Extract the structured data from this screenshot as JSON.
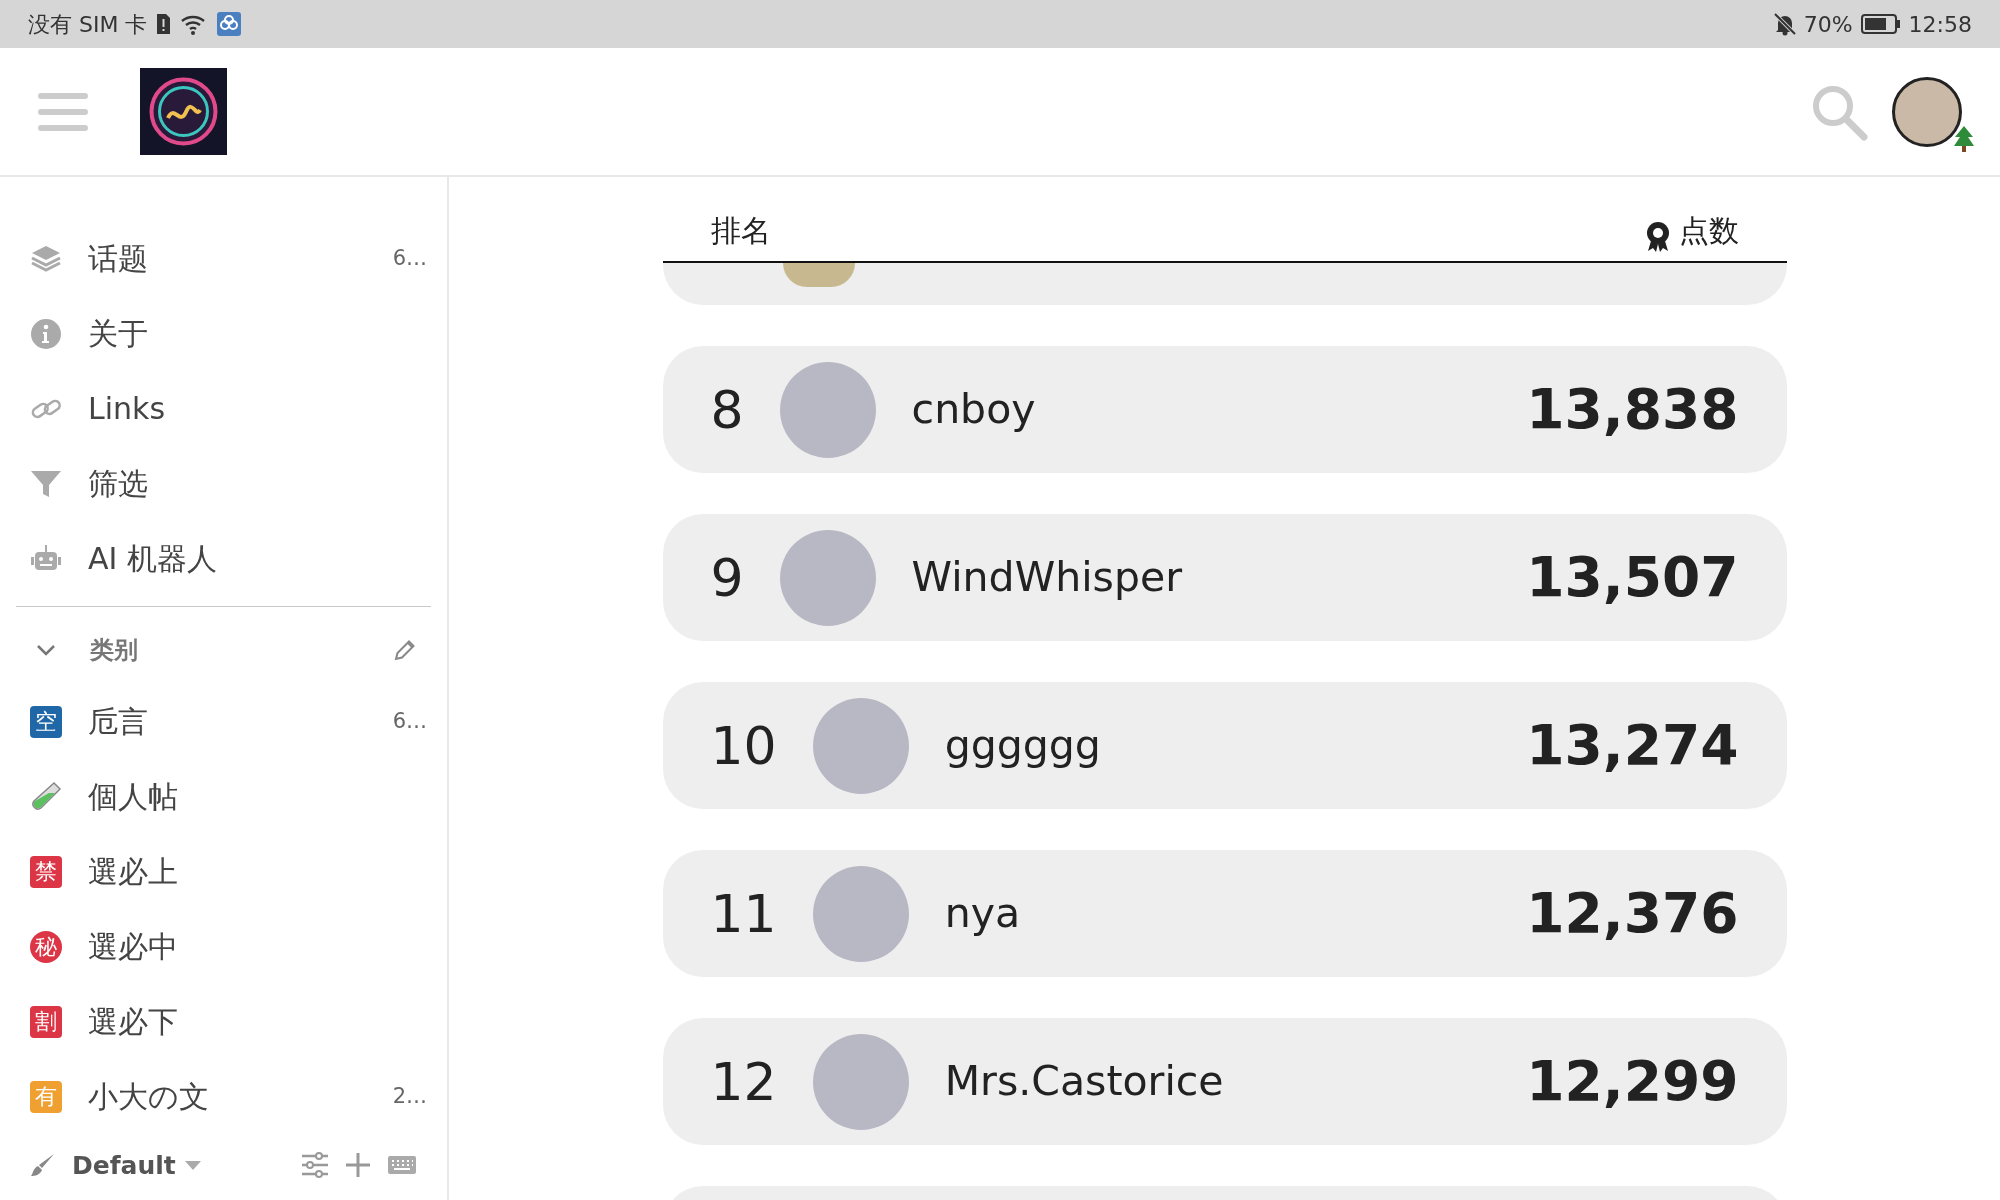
{
  "status_bar": {
    "carrier": "没有 SIM 卡",
    "battery": "70%",
    "time": "12:58"
  },
  "sidebar": {
    "items": [
      {
        "label": "话题",
        "count": "6…",
        "kind": "layers"
      },
      {
        "label": "关于",
        "kind": "info"
      },
      {
        "label": "Links",
        "kind": "link"
      },
      {
        "label": "筛选",
        "kind": "filter"
      },
      {
        "label": "AI 机器人",
        "kind": "robot"
      }
    ],
    "categories": {
      "title": "类别",
      "expanded": true,
      "items": [
        {
          "label": "卮言",
          "count": "6…",
          "kind": "square",
          "glyph": "空",
          "color": "#1f67a6"
        },
        {
          "label": "個人帖",
          "kind": "tube"
        },
        {
          "label": "選必上",
          "kind": "square",
          "glyph": "禁",
          "color": "#dc3545"
        },
        {
          "label": "選必中",
          "kind": "circle",
          "glyph": "秘",
          "color": "#dc3545"
        },
        {
          "label": "選必下",
          "kind": "square",
          "glyph": "割",
          "color": "#dc3545"
        },
        {
          "label": "小大の文",
          "count": "2…",
          "kind": "square",
          "glyph": "有",
          "color": "#f0a030"
        }
      ]
    },
    "footer": {
      "theme": "Default"
    }
  },
  "leaderboard": {
    "columns": [
      "排名",
      "点数"
    ],
    "rows": [
      {
        "rank": "8",
        "name": "cnboy",
        "score": "13,838"
      },
      {
        "rank": "9",
        "name": "WindWhisper",
        "score": "13,507"
      },
      {
        "rank": "10",
        "name": "gggggg",
        "score": "13,274"
      },
      {
        "rank": "11",
        "name": "nya",
        "score": "12,376"
      },
      {
        "rank": "12",
        "name": "Mrs.Castorice",
        "score": "12,299"
      }
    ]
  }
}
